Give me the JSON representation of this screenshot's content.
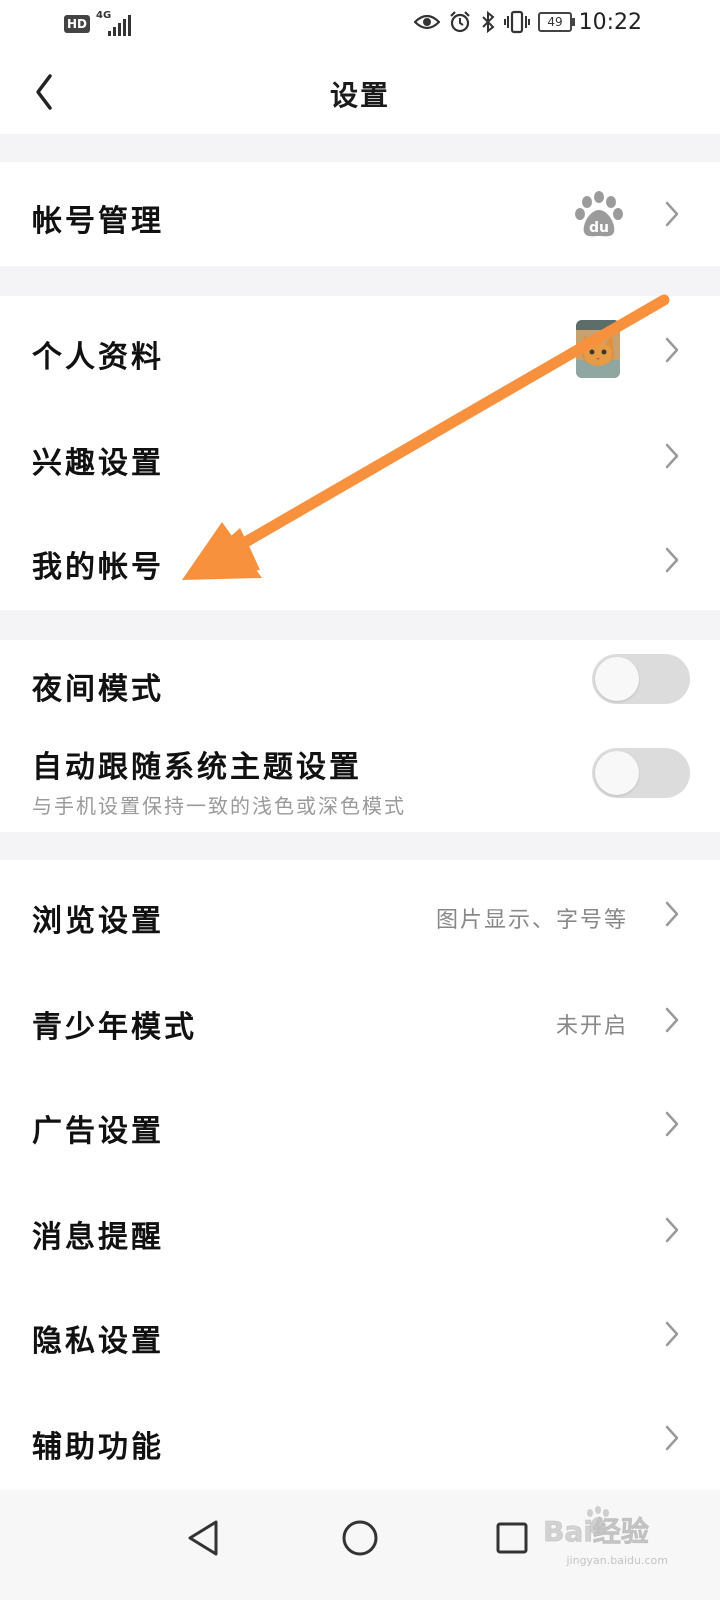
{
  "status_bar": {
    "hd_label": "HD",
    "network_label": "4G",
    "battery_level": "49",
    "time": "10:22"
  },
  "header": {
    "title": "设置"
  },
  "sections": {
    "account_management": {
      "label": "帐号管理"
    },
    "personal_info": {
      "label": "个人资料"
    },
    "interest_settings": {
      "label": "兴趣设置"
    },
    "my_account": {
      "label": "我的帐号"
    },
    "night_mode": {
      "label": "夜间模式",
      "enabled": false
    },
    "follow_system_theme": {
      "label": "自动跟随系统主题设置",
      "sublabel": "与手机设置保持一致的浅色或深色模式",
      "enabled": false
    },
    "browse_settings": {
      "label": "浏览设置",
      "value": "图片显示、字号等"
    },
    "teen_mode": {
      "label": "青少年模式",
      "value": "未开启"
    },
    "ad_settings": {
      "label": "广告设置"
    },
    "notifications": {
      "label": "消息提醒"
    },
    "privacy_settings": {
      "label": "隐私设置"
    },
    "accessibility": {
      "label": "辅助功能"
    }
  },
  "watermark": {
    "text": "Bai经验",
    "url_text": "jingyan.baidu.com"
  },
  "colors": {
    "annotation_arrow": "#f7913d",
    "section_gap": "#f4f4f6",
    "toggle_off": "#dcdcdc"
  }
}
